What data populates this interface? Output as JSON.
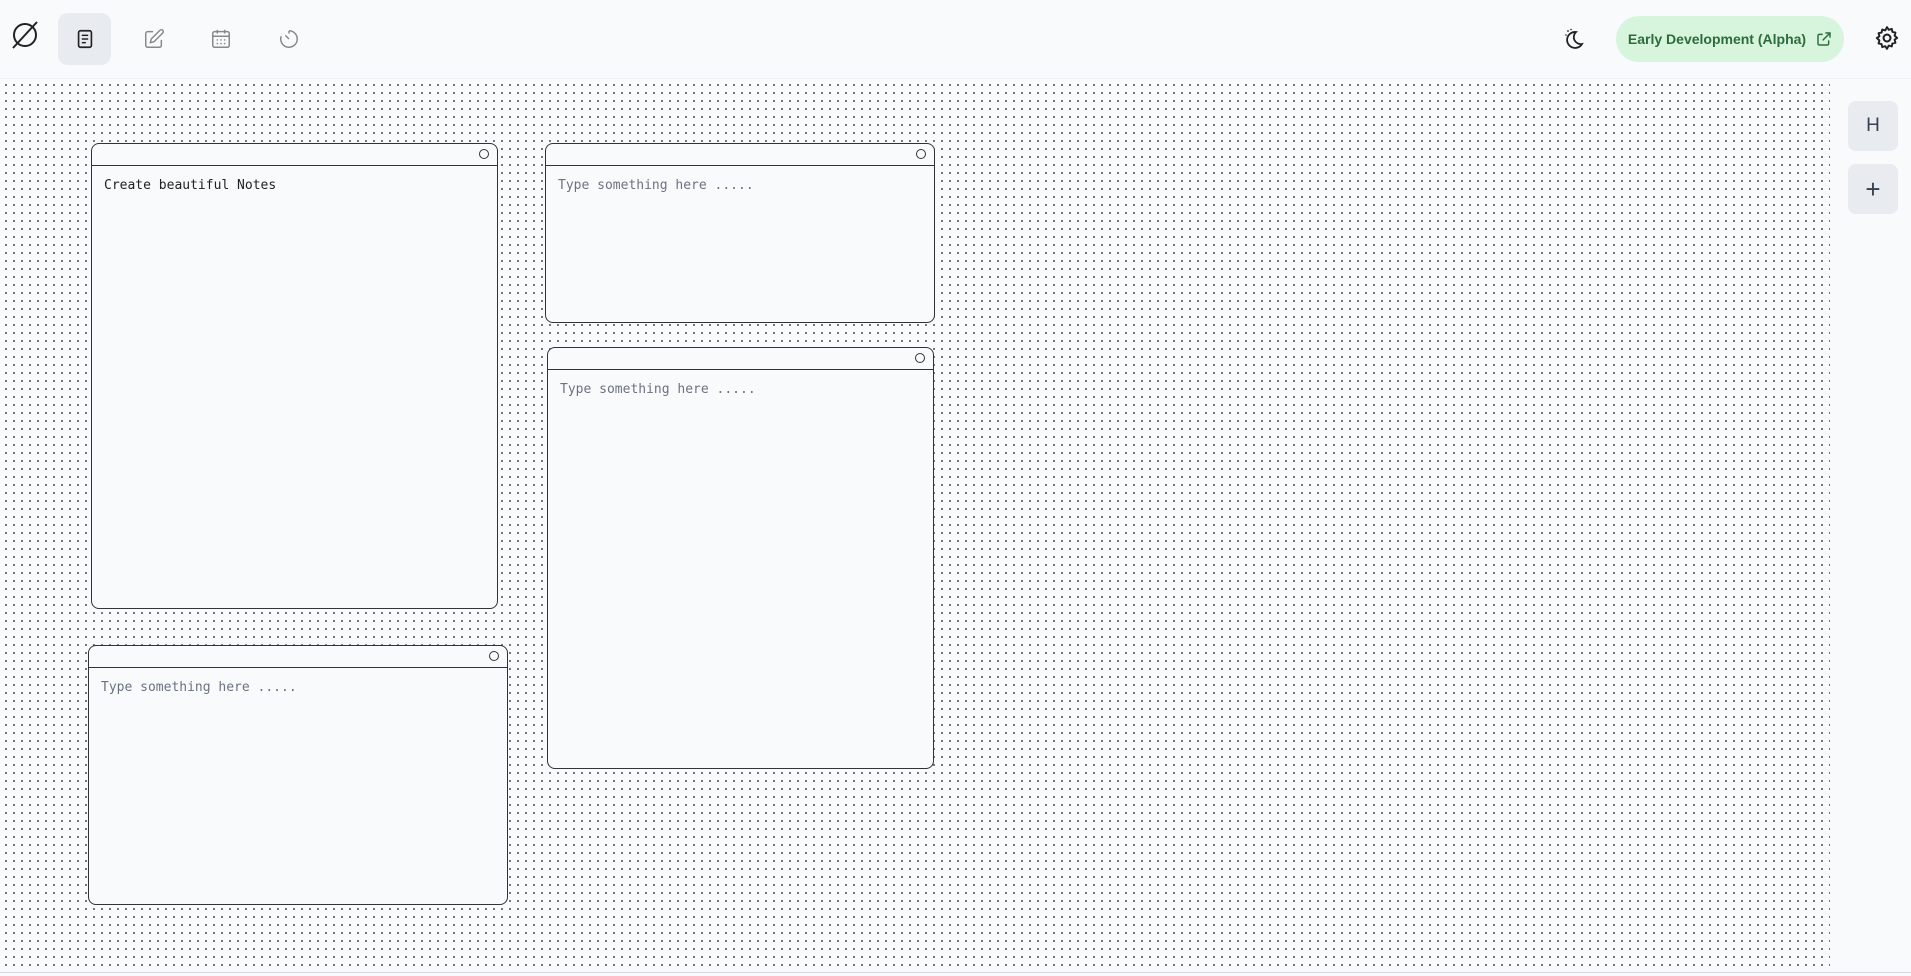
{
  "app": {
    "logo_icon": "empty-set-icon"
  },
  "nav": {
    "items": [
      {
        "name": "notes",
        "icon": "document-icon",
        "active": true
      },
      {
        "name": "editor",
        "icon": "pencil-square-icon",
        "active": false
      },
      {
        "name": "calendar",
        "icon": "calendar-icon",
        "active": false
      },
      {
        "name": "timer",
        "icon": "timer-icon",
        "active": false
      }
    ]
  },
  "header": {
    "theme_icon": "moon-stars-icon",
    "badge_label": "Early Development (Alpha)",
    "badge_icon": "external-link-icon",
    "badge_color": "#d6f5dc",
    "settings_icon": "gear-icon"
  },
  "sidebar": {
    "heading_button_label": "H",
    "add_button_label": "+"
  },
  "notes": [
    {
      "value": "Create beautiful Notes",
      "placeholder": "Type something here ....."
    },
    {
      "value": "",
      "placeholder": "Type something here ....."
    },
    {
      "value": "",
      "placeholder": "Type something here ....."
    },
    {
      "value": "",
      "placeholder": "Type something here ....."
    }
  ]
}
